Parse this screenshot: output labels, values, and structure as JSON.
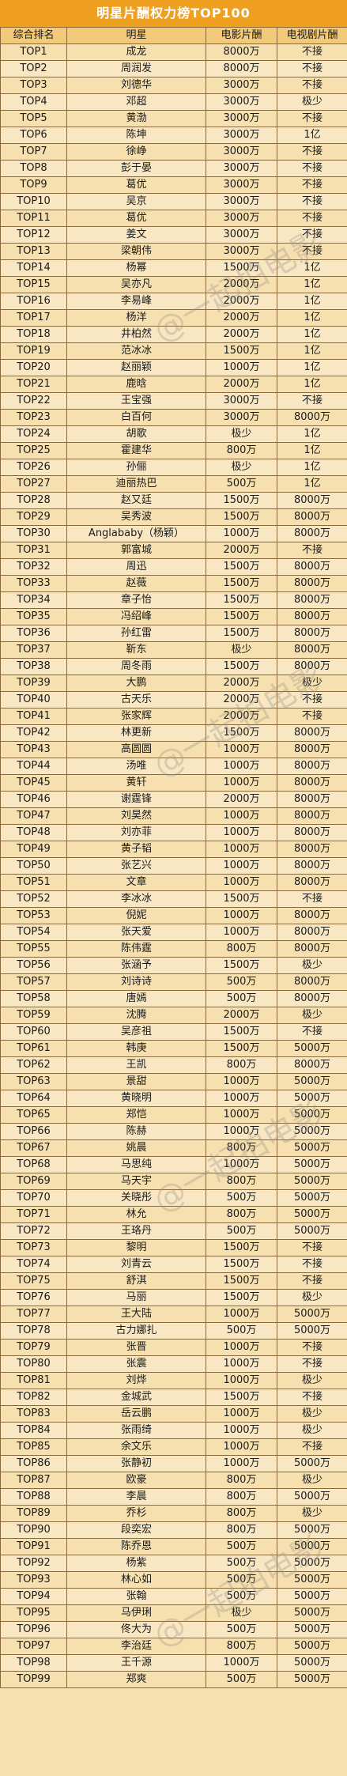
{
  "title": "明星片酬权力榜TOP100",
  "headers": [
    "综合排名",
    "明星",
    "电影片酬",
    "电视剧片酬"
  ],
  "watermark": "@一起拍电影",
  "rows": [
    [
      "TOP1",
      "成龙",
      "8000万",
      "不接"
    ],
    [
      "TOP2",
      "周润发",
      "8000万",
      "不接"
    ],
    [
      "TOP3",
      "刘德华",
      "3000万",
      "不接"
    ],
    [
      "TOP4",
      "邓超",
      "3000万",
      "极少"
    ],
    [
      "TOP5",
      "黄渤",
      "3000万",
      "不接"
    ],
    [
      "TOP6",
      "陈坤",
      "3000万",
      "1亿"
    ],
    [
      "TOP7",
      "徐峥",
      "3000万",
      "不接"
    ],
    [
      "TOP8",
      "彭于晏",
      "3000万",
      "不接"
    ],
    [
      "TOP9",
      "葛优",
      "3000万",
      "不接"
    ],
    [
      "TOP10",
      "吴京",
      "3000万",
      "不接"
    ],
    [
      "TOP11",
      "葛优",
      "3000万",
      "不接"
    ],
    [
      "TOP12",
      "姜文",
      "3000万",
      "不接"
    ],
    [
      "TOP13",
      "梁朝伟",
      "3000万",
      "不接"
    ],
    [
      "TOP14",
      "杨幂",
      "1500万",
      "1亿"
    ],
    [
      "TOP15",
      "吴亦凡",
      "2000万",
      "1亿"
    ],
    [
      "TOP16",
      "李易峰",
      "2000万",
      "1亿"
    ],
    [
      "TOP17",
      "杨洋",
      "2000万",
      "1亿"
    ],
    [
      "TOP18",
      "井柏然",
      "2000万",
      "1亿"
    ],
    [
      "TOP19",
      "范冰冰",
      "1500万",
      "1亿"
    ],
    [
      "TOP20",
      "赵丽颖",
      "1000万",
      "1亿"
    ],
    [
      "TOP21",
      "鹿晗",
      "2000万",
      "1亿"
    ],
    [
      "TOP22",
      "王宝强",
      "3000万",
      "不接"
    ],
    [
      "TOP23",
      "白百何",
      "3000万",
      "8000万"
    ],
    [
      "TOP24",
      "胡歌",
      "极少",
      "1亿"
    ],
    [
      "TOP25",
      "霍建华",
      "800万",
      "1亿"
    ],
    [
      "TOP26",
      "孙俪",
      "极少",
      "1亿"
    ],
    [
      "TOP27",
      "迪丽热巴",
      "500万",
      "1亿"
    ],
    [
      "TOP28",
      "赵又廷",
      "1500万",
      "8000万"
    ],
    [
      "TOP29",
      "吴秀波",
      "1500万",
      "8000万"
    ],
    [
      "TOP30",
      "Anglababy（杨颖）",
      "1000万",
      "8000万"
    ],
    [
      "TOP31",
      "郭富城",
      "2000万",
      "不接"
    ],
    [
      "TOP32",
      "周迅",
      "1500万",
      "8000万"
    ],
    [
      "TOP33",
      "赵薇",
      "1500万",
      "8000万"
    ],
    [
      "TOP34",
      "章子怡",
      "1500万",
      "8000万"
    ],
    [
      "TOP35",
      "冯绍峰",
      "1500万",
      "8000万"
    ],
    [
      "TOP36",
      "孙红雷",
      "1500万",
      "8000万"
    ],
    [
      "TOP37",
      "靳东",
      "极少",
      "8000万"
    ],
    [
      "TOP38",
      "周冬雨",
      "1500万",
      "8000万"
    ],
    [
      "TOP39",
      "大鹏",
      "2000万",
      "极少"
    ],
    [
      "TOP40",
      "古天乐",
      "2000万",
      "不接"
    ],
    [
      "TOP41",
      "张家辉",
      "2000万",
      "不接"
    ],
    [
      "TOP42",
      "林更新",
      "1500万",
      "8000万"
    ],
    [
      "TOP43",
      "高圆圆",
      "1000万",
      "8000万"
    ],
    [
      "TOP44",
      "汤唯",
      "1000万",
      "8000万"
    ],
    [
      "TOP45",
      "黄轩",
      "1000万",
      "8000万"
    ],
    [
      "TOP46",
      "谢霆锋",
      "2000万",
      "8000万"
    ],
    [
      "TOP47",
      "刘昊然",
      "1000万",
      "8000万"
    ],
    [
      "TOP48",
      "刘亦菲",
      "1000万",
      "8000万"
    ],
    [
      "TOP49",
      "黄子韬",
      "1000万",
      "8000万"
    ],
    [
      "TOP50",
      "张艺兴",
      "1000万",
      "8000万"
    ],
    [
      "TOP51",
      "文章",
      "1000万",
      "8000万"
    ],
    [
      "TOP52",
      "李冰冰",
      "1500万",
      "不接"
    ],
    [
      "TOP53",
      "倪妮",
      "1000万",
      "8000万"
    ],
    [
      "TOP54",
      "张天爱",
      "1000万",
      "8000万"
    ],
    [
      "TOP55",
      "陈伟霆",
      "800万",
      "8000万"
    ],
    [
      "TOP56",
      "张涵予",
      "1500万",
      "极少"
    ],
    [
      "TOP57",
      "刘诗诗",
      "500万",
      "8000万"
    ],
    [
      "TOP58",
      "唐嫣",
      "500万",
      "8000万"
    ],
    [
      "TOP59",
      "沈腾",
      "2000万",
      "极少"
    ],
    [
      "TOP60",
      "吴彦祖",
      "1500万",
      "不接"
    ],
    [
      "TOP61",
      "韩庚",
      "1500万",
      "5000万"
    ],
    [
      "TOP62",
      "王凯",
      "800万",
      "8000万"
    ],
    [
      "TOP63",
      "景甜",
      "1000万",
      "5000万"
    ],
    [
      "TOP64",
      "黄晓明",
      "1000万",
      "5000万"
    ],
    [
      "TOP65",
      "郑恺",
      "1000万",
      "5000万"
    ],
    [
      "TOP66",
      "陈赫",
      "1000万",
      "5000万"
    ],
    [
      "TOP67",
      "姚晨",
      "800万",
      "5000万"
    ],
    [
      "TOP68",
      "马思纯",
      "1000万",
      "5000万"
    ],
    [
      "TOP69",
      "马天宇",
      "800万",
      "5000万"
    ],
    [
      "TOP70",
      "关晓彤",
      "500万",
      "5000万"
    ],
    [
      "TOP71",
      "林允",
      "800万",
      "5000万"
    ],
    [
      "TOP72",
      "王珞丹",
      "500万",
      "5000万"
    ],
    [
      "TOP73",
      "黎明",
      "1500万",
      "不接"
    ],
    [
      "TOP74",
      "刘青云",
      "1500万",
      "不接"
    ],
    [
      "TOP75",
      "舒淇",
      "1500万",
      "不接"
    ],
    [
      "TOP76",
      "马丽",
      "1500万",
      "极少"
    ],
    [
      "TOP77",
      "王大陆",
      "1000万",
      "5000万"
    ],
    [
      "TOP78",
      "古力娜扎",
      "500万",
      "5000万"
    ],
    [
      "TOP79",
      "张晋",
      "1000万",
      "不接"
    ],
    [
      "TOP80",
      "张震",
      "1000万",
      "不接"
    ],
    [
      "TOP81",
      "刘烨",
      "1000万",
      "极少"
    ],
    [
      "TOP82",
      "金城武",
      "1500万",
      "不接"
    ],
    [
      "TOP83",
      "岳云鹏",
      "1000万",
      "极少"
    ],
    [
      "TOP84",
      "张雨绮",
      "1000万",
      "极少"
    ],
    [
      "TOP85",
      "余文乐",
      "1000万",
      "不接"
    ],
    [
      "TOP86",
      "张静初",
      "1000万",
      "5000万"
    ],
    [
      "TOP87",
      "欧豪",
      "800万",
      "极少"
    ],
    [
      "TOP88",
      "李晨",
      "800万",
      "5000万"
    ],
    [
      "TOP89",
      "乔杉",
      "800万",
      "极少"
    ],
    [
      "TOP90",
      "段奕宏",
      "800万",
      "5000万"
    ],
    [
      "TOP91",
      "陈乔恩",
      "500万",
      "5000万"
    ],
    [
      "TOP92",
      "杨紫",
      "500万",
      "5000万"
    ],
    [
      "TOP93",
      "林心如",
      "500万",
      "5000万"
    ],
    [
      "TOP94",
      "张翰",
      "500万",
      "5000万"
    ],
    [
      "TOP95",
      "马伊琍",
      "极少",
      "5000万"
    ],
    [
      "TOP96",
      "佟大为",
      "500万",
      "5000万"
    ],
    [
      "TOP97",
      "李治廷",
      "800万",
      "5000万"
    ],
    [
      "TOP98",
      "王千源",
      "1000万",
      "5000万"
    ],
    [
      "TOP99",
      "郑爽",
      "500万",
      "5000万"
    ]
  ]
}
